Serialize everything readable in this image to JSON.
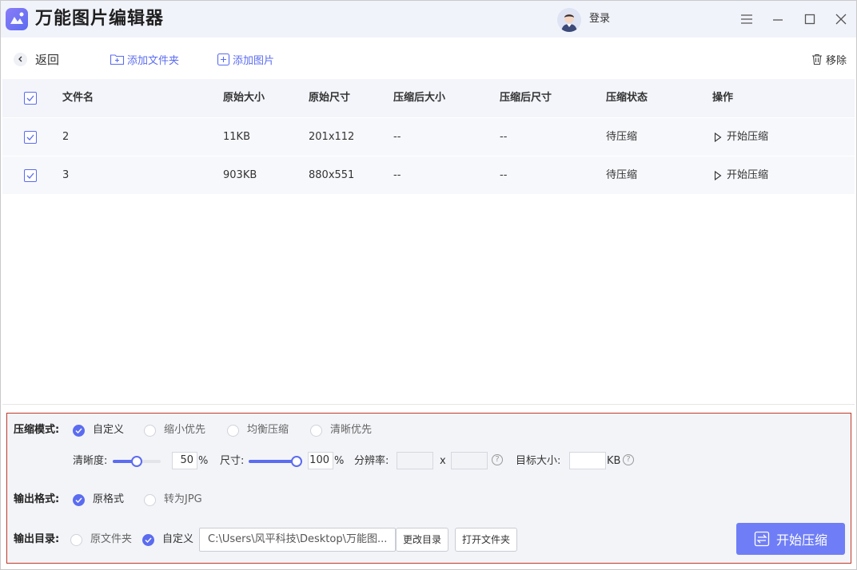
{
  "app": {
    "title": "万能图片编辑器",
    "login_label": "登录"
  },
  "toolbar": {
    "back_label": "返回",
    "add_folder_label": "添加文件夹",
    "add_image_label": "添加图片",
    "remove_label": "移除"
  },
  "table": {
    "headers": [
      "文件名",
      "原始大小",
      "原始尺寸",
      "压缩后大小",
      "压缩后尺寸",
      "压缩状态",
      "操作"
    ],
    "rows": [
      {
        "name": "2",
        "orig_size": "11KB",
        "orig_dim": "201x112",
        "new_size": "--",
        "new_dim": "--",
        "status": "待压缩",
        "action": "开始压缩",
        "checked": true
      },
      {
        "name": "3",
        "orig_size": "903KB",
        "orig_dim": "880x551",
        "new_size": "--",
        "new_dim": "--",
        "status": "待压缩",
        "action": "开始压缩",
        "checked": true
      }
    ]
  },
  "settings": {
    "mode_label": "压缩模式:",
    "modes": [
      "自定义",
      "缩小优先",
      "均衡压缩",
      "清晰优先"
    ],
    "mode_selected": "自定义",
    "clarity_label": "清晰度:",
    "clarity_value": "50",
    "size_label": "尺寸:",
    "size_value": "100",
    "percent_unit": "%",
    "resolution_label": "分辨率:",
    "resolution_x": "x",
    "target_size_label": "目标大小:",
    "target_size_unit": "KB",
    "help_icon_text": "?",
    "format_label": "输出格式:",
    "formats": [
      "原格式",
      "转为JPG"
    ],
    "format_selected": "原格式",
    "dir_label": "输出目录:",
    "dir_options": [
      "原文件夹",
      "自定义"
    ],
    "dir_selected": "自定义",
    "dir_path": "C:\\Users\\风平科技\\Desktop\\万能图...",
    "change_dir_label": "更改目录",
    "open_folder_label": "打开文件夹",
    "start_label": "开始压缩"
  },
  "colors": {
    "accent": "#5b6cf0",
    "panel_border": "#c0392b"
  }
}
